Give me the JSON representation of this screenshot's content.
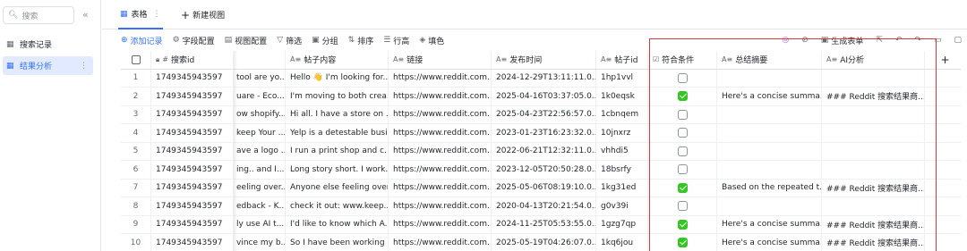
{
  "sidebar": {
    "search_placeholder": "搜索",
    "items": [
      {
        "label": "搜索记录",
        "icon": "table-icon"
      },
      {
        "label": "结果分析",
        "icon": "table-icon"
      }
    ]
  },
  "tabs": {
    "active_label": "表格",
    "new_view_label": "新建视图"
  },
  "toolbar": {
    "add_record": "添加记录",
    "field_config": "字段配置",
    "view_config": "视图配置",
    "filter": "筛选",
    "group": "分组",
    "sort": "排序",
    "row_height": "行高",
    "fill_color": "填色",
    "generate_form": "生成表单"
  },
  "columns": {
    "search_id": "搜索id",
    "content": "帖子内容",
    "link": "链接",
    "published": "发布时间",
    "post_id": "帖子id",
    "qualified": "符合条件",
    "summary": "总结摘要",
    "ai_analysis": "AI分析"
  },
  "rows": [
    {
      "idx": "1",
      "sid": "1749345943597",
      "title": "tool are yo...",
      "content": "Hello 👋 I'm looking for...",
      "link": "https://www.reddit.com...",
      "date": "2024-12-29T13:11:11.0...",
      "pid": "1hp1vvl",
      "ok": false,
      "sum": "",
      "ai": ""
    },
    {
      "idx": "2",
      "sid": "1749345943597",
      "title": "uare - Eco...",
      "content": "I'm moving to both crea...",
      "link": "https://www.reddit.com...",
      "date": "2025-04-16T03:37:05.0...",
      "pid": "1k0eqsk",
      "ok": true,
      "sum": "Here's a concise summa...",
      "ai": "### Reddit 搜索结果商..."
    },
    {
      "idx": "3",
      "sid": "1749345943597",
      "title": "ow shopify...",
      "content": "Hi all. I have a store on ...",
      "link": "https://www.reddit.com...",
      "date": "2025-04-23T22:56:57.0...",
      "pid": "1cbnqem",
      "ok": false,
      "sum": "",
      "ai": ""
    },
    {
      "idx": "4",
      "sid": "1749345943597",
      "title": "keep Your ...",
      "content": "Yelp is a detestable busi...",
      "link": "https://www.reddit.com...",
      "date": "2023-01-23T16:23:32.0...",
      "pid": "10jnxrz",
      "ok": false,
      "sum": "",
      "ai": ""
    },
    {
      "idx": "5",
      "sid": "1749345943597",
      "title": "ave a logo ...",
      "content": "I run a print shop and c...",
      "link": "https://www.reddit.com...",
      "date": "2022-06-21T12:32:11.0...",
      "pid": "vhhdi5",
      "ok": false,
      "sum": "",
      "ai": ""
    },
    {
      "idx": "6",
      "sid": "1749345943597",
      "title": "ing.. and I...",
      "content": "Long story short. I work...",
      "link": "https://www.reddit.com...",
      "date": "2023-12-05T20:50:28.0...",
      "pid": "18bsrfy",
      "ok": false,
      "sum": "",
      "ai": ""
    },
    {
      "idx": "7",
      "sid": "1749345943597",
      "title": "eeling over...",
      "content": "Anyone else feeling over...",
      "link": "https://www.reddit.com...",
      "date": "2025-05-06T08:19:10.0...",
      "pid": "1kg31ed",
      "ok": true,
      "sum": "Based on the repeated t...",
      "ai": "### Reddit 搜索结果商..."
    },
    {
      "idx": "8",
      "sid": "1749345943597",
      "title": "edback - K...",
      "content": "check it out: www.keep...",
      "link": "https://www.reddit.com...",
      "date": "2020-04-13T20:21:54.0...",
      "pid": "g0v39i",
      "ok": false,
      "sum": "",
      "ai": ""
    },
    {
      "idx": "9",
      "sid": "1749345943597",
      "title": "ly use AI t...",
      "content": "I'd like to know which A...",
      "link": "https://www.reddit.com...",
      "date": "2024-11-25T05:53:55.0...",
      "pid": "1gzg7qp",
      "ok": true,
      "sum": "Here's a concise summa...",
      "ai": "### Reddit 搜索结果商..."
    },
    {
      "idx": "10",
      "sid": "1749345943597",
      "title": "vince my b...",
      "content": "So I have been working ...",
      "link": "https://www.reddit.com...",
      "date": "2025-05-19T04:26:07.0...",
      "pid": "1kq6jou",
      "ok": true,
      "sum": "Here's a concise summa...",
      "ai": "### Reddit 搜索结果商..."
    }
  ],
  "colors": {
    "accent": "#3370ff",
    "checked": "#34c724",
    "highlight_box": "#d9363e"
  }
}
